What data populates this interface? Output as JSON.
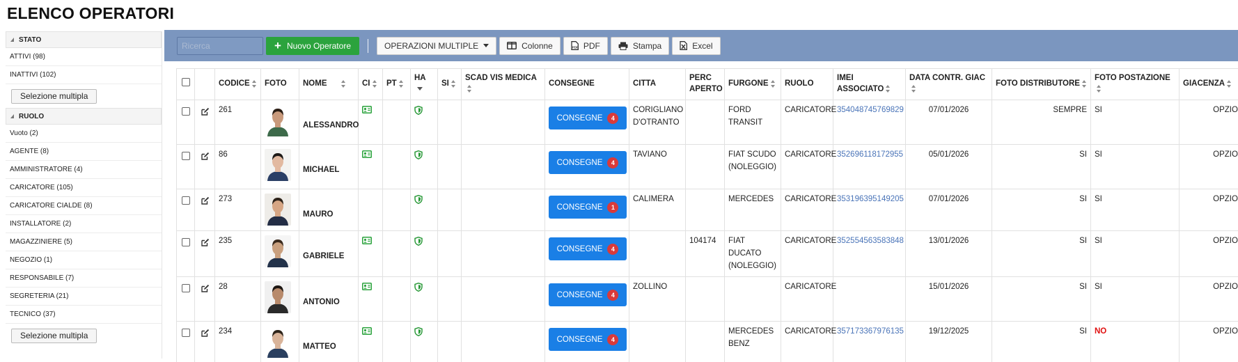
{
  "page": {
    "title": "ELENCO OPERATORI"
  },
  "sidebar": {
    "stato_title": "STATO",
    "stato_items": [
      "ATTIVI (98)",
      "INATTIVI (102)"
    ],
    "multi_select_label": "Selezione multipla",
    "ruolo_title": "RUOLO",
    "ruolo_items": [
      "Vuoto (2)",
      "AGENTE (8)",
      "AMMINISTRATORE (4)",
      "CARICATORE (105)",
      "CARICATORE CIALDE (8)",
      "INSTALLATORE (2)",
      "MAGAZZINIERE (5)",
      "NEGOZIO (1)",
      "RESPONSABILE (7)",
      "SEGRETERIA (21)",
      "TECNICO (37)"
    ]
  },
  "toolbar": {
    "search_placeholder": "Ricerca",
    "new_operator_label": "Nuovo Operatore",
    "multi_ops_label": "OPERAZIONI MULTIPLE",
    "columns_label": "Colonne",
    "pdf_label": "PDF",
    "print_label": "Stampa",
    "excel_label": "Excel"
  },
  "table": {
    "headers": {
      "codice": "CODICE",
      "foto": "FOTO",
      "nome": "NOME",
      "ci": "CI",
      "pt": "PT",
      "ha": "HA",
      "si": "SI",
      "scad": "SCAD VIS MEDICA",
      "consegne": "CONSEGNE",
      "citta": "CITTA",
      "perc": "PERC APERTO",
      "furgone": "FURGONE",
      "ruolo": "RUOLO",
      "imei": "IMEI ASSOCIATO",
      "data": "DATA CONTR. GIAC",
      "foto_distr": "FOTO DISTRIBUTORE",
      "foto_post": "FOTO POSTAZIONE",
      "giacenza": "GIACENZA"
    },
    "consegne_label": "CONSEGNE",
    "rows": [
      {
        "codice": "261",
        "nome": "ALESSANDRO",
        "badge": "4",
        "citta": "CORIGLIANO D'OTRANTO",
        "perc": "",
        "furgone_1": "FORD",
        "furgone_2": "TRANSIT",
        "ruolo": "CARICATORE",
        "imei": "354048745769829",
        "data": "07/01/2026",
        "foto_distr": "SEMPRE",
        "foto_post": "SI",
        "giacenza": "OPZIONALE"
      },
      {
        "codice": "86",
        "nome": "MICHAEL",
        "badge": "4",
        "citta": "TAVIANO",
        "perc": "",
        "furgone_1": "FIAT SCUDO",
        "furgone_2": "(NOLEGGIO)",
        "ruolo": "CARICATORE",
        "imei": "352696118172955",
        "data": "05/01/2026",
        "foto_distr": "SI",
        "foto_post": "SI",
        "giacenza": "OPZIONALE"
      },
      {
        "codice": "273",
        "nome": "MAURO",
        "badge": "1",
        "citta": "CALIMERA",
        "perc": "",
        "furgone_1": "MERCEDES",
        "furgone_2": "",
        "ruolo": "CARICATORE",
        "imei": "353196395149205",
        "data": "07/01/2026",
        "foto_distr": "SI",
        "foto_post": "SI",
        "giacenza": "OPZIONALE"
      },
      {
        "codice": "235",
        "nome": "GABRIELE",
        "badge": "4",
        "citta": "",
        "perc": "104174",
        "furgone_1": "FIAT DUCATO",
        "furgone_2": "(NOLEGGIO)",
        "ruolo": "CARICATORE",
        "imei": "352554563583848",
        "data": "13/01/2026",
        "foto_distr": "SI",
        "foto_post": "SI",
        "giacenza": "OPZIONALE"
      },
      {
        "codice": "28",
        "nome": "ANTONIO",
        "badge": "4",
        "citta": "ZOLLINO",
        "perc": "",
        "furgone_1": "",
        "furgone_2": "",
        "ruolo": "CARICATORE",
        "imei": "",
        "data": "15/01/2026",
        "foto_distr": "SI",
        "foto_post": "SI",
        "giacenza": "OPZIONALE"
      },
      {
        "codice": "234",
        "nome": "MATTEO",
        "badge": "4",
        "citta": "",
        "perc": "",
        "furgone_1": "MERCEDES",
        "furgone_2": "BENZ",
        "ruolo": "CARICATORE",
        "imei": "357173367976135",
        "data": "19/12/2025",
        "foto_distr": "SI",
        "foto_post": "NO",
        "giacenza": "OPZIONALE"
      }
    ]
  },
  "colors": {
    "toolbar_bg": "#7b96bf",
    "new_button": "#2ba33d",
    "consegne_button": "#1a7fe6",
    "badge": "#d93a3a",
    "ci_icon": "#2ba33d",
    "ha_icon": "#2b9a3a",
    "imei_link": "#4a74b8",
    "no_text": "#e01010"
  },
  "icons": {
    "ci": "id-card-icon",
    "ha": "shield-icon",
    "edit": "edit-icon",
    "photo": "operator-photo"
  }
}
